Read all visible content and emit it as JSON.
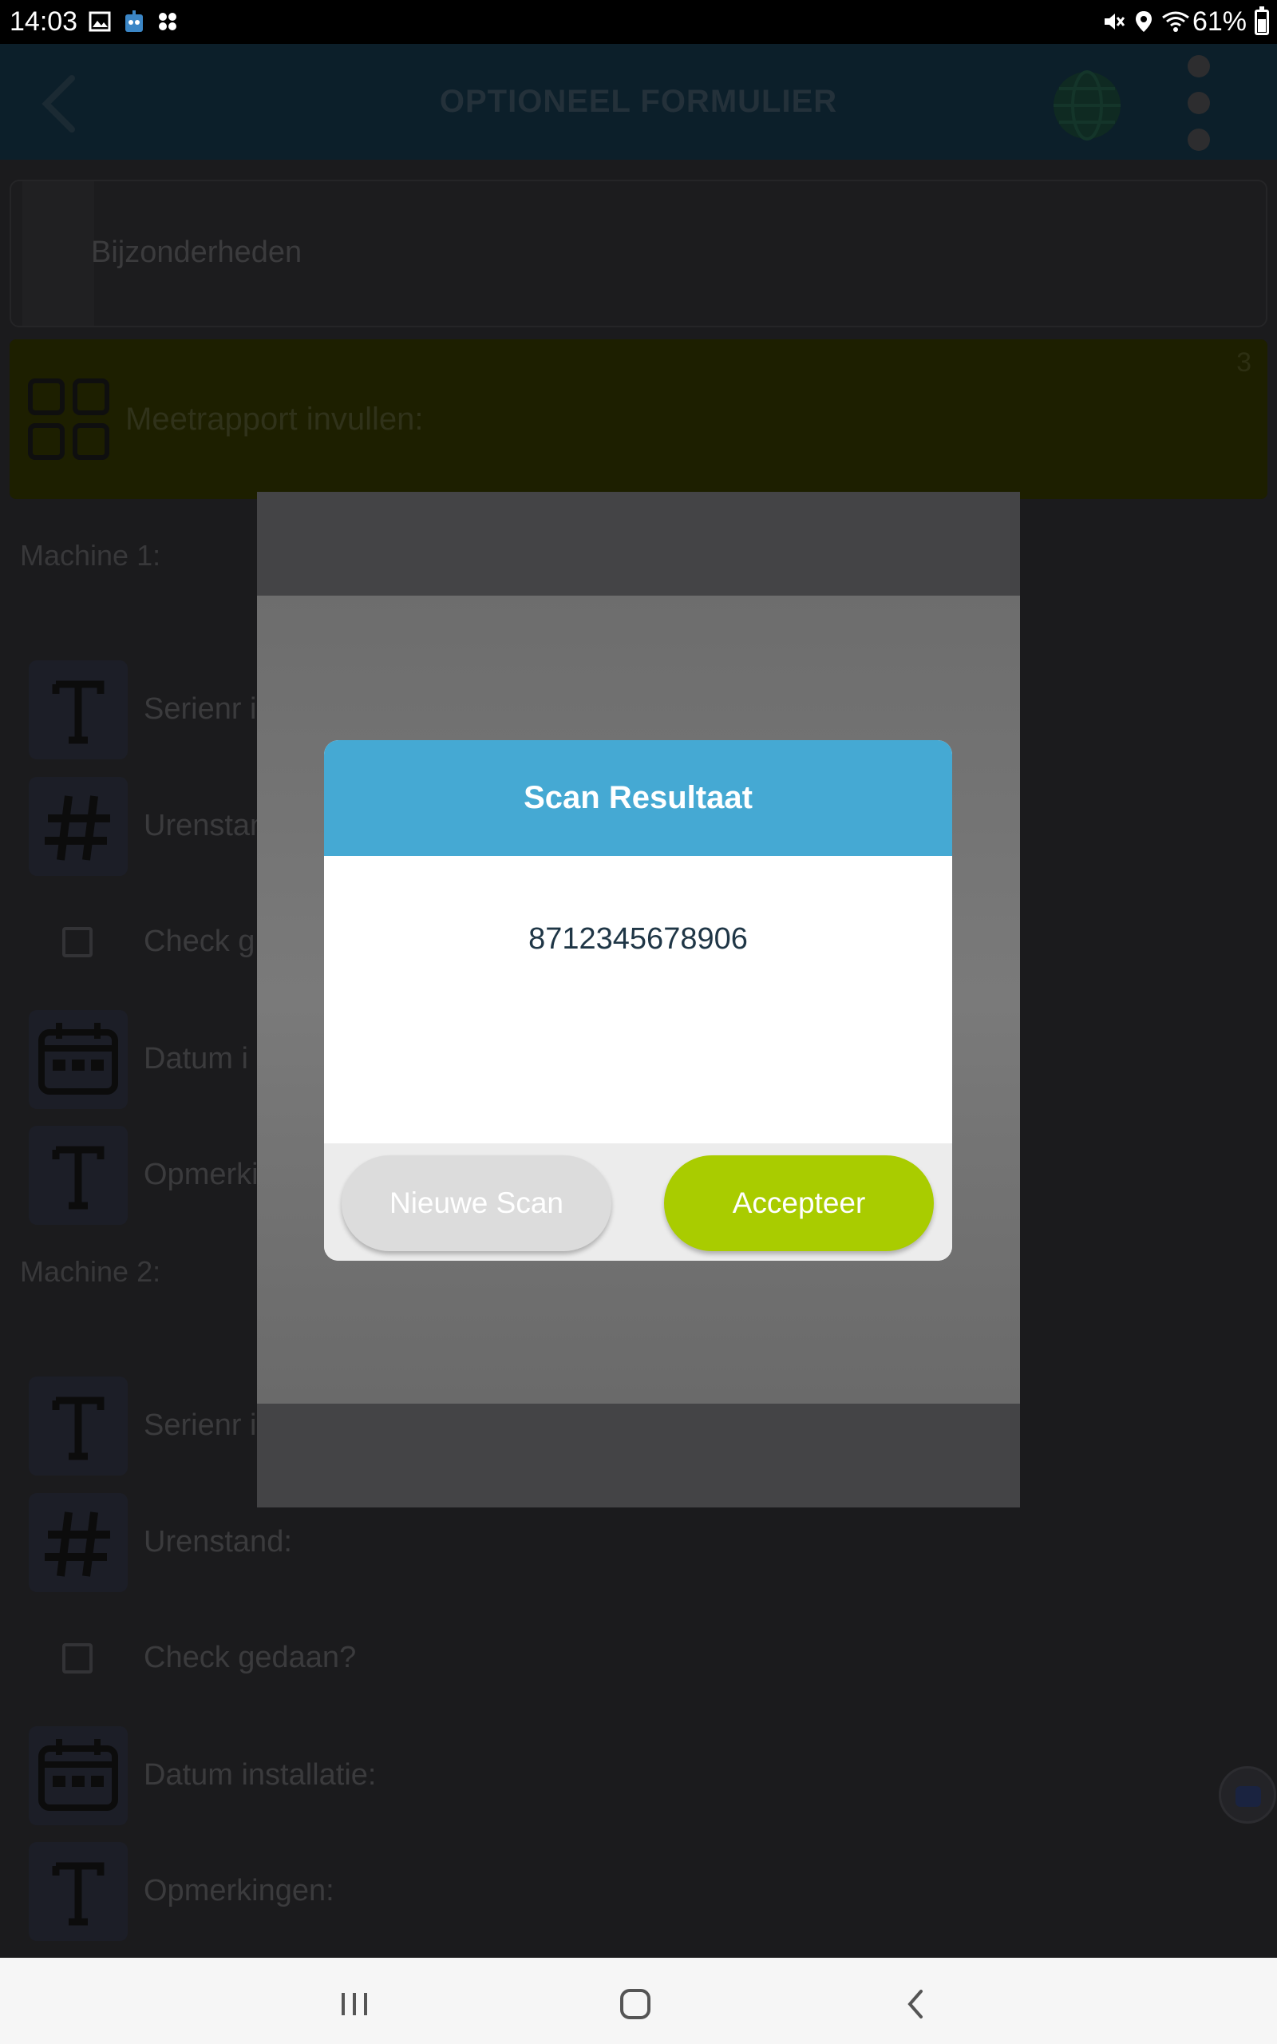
{
  "status_bar": {
    "time": "14:03",
    "battery": "61%",
    "battery_level": 0.61,
    "left_icons": [
      "gallery-icon",
      "robot-app-icon",
      "apps-icon"
    ],
    "right_icons": [
      "mute-icon",
      "location-icon",
      "wifi-icon",
      "battery-icon"
    ]
  },
  "app_bar": {
    "title": "OPTIONEEL FORMULIER",
    "icons": [
      "back-arrow-icon",
      "globe-icon",
      "more-vertical-icon"
    ]
  },
  "form": {
    "notes_card": {
      "label": "Bijzonderheden"
    },
    "group": {
      "label": "Meetrapport invullen:",
      "count": "3",
      "icon": "grid-form-icon"
    },
    "machines": [
      {
        "title": "Machine 1:",
        "fields": [
          {
            "type": "text",
            "icon": "text-field-icon",
            "label": "Serienr i"
          },
          {
            "type": "number",
            "icon": "hash-icon",
            "label": "Urenstan"
          },
          {
            "type": "checkbox",
            "icon": "checkbox-icon",
            "label": "Check g"
          },
          {
            "type": "date",
            "icon": "calendar-icon",
            "label": "Datum i"
          },
          {
            "type": "text",
            "icon": "text-field-icon",
            "label": "Opmerki"
          }
        ]
      },
      {
        "title": "Machine 2:",
        "fields": [
          {
            "type": "text",
            "icon": "text-field-icon",
            "label": "Serienr i"
          },
          {
            "type": "number",
            "icon": "hash-icon",
            "label": "Urenstand:"
          },
          {
            "type": "checkbox",
            "icon": "checkbox-icon",
            "label": "Check gedaan?"
          },
          {
            "type": "date",
            "icon": "calendar-icon",
            "label": "Datum installatie:"
          },
          {
            "type": "text",
            "icon": "text-field-icon",
            "label": "Opmerkingen:"
          }
        ]
      }
    ]
  },
  "dialog": {
    "title": "Scan Resultaat",
    "result": "8712345678906",
    "secondary_button": "Nieuwe Scan",
    "primary_button": "Accepteer"
  },
  "nav_bar": {
    "icons": [
      "recents-icon",
      "home-icon",
      "back-icon"
    ]
  },
  "colors": {
    "dialog_header": "#45a9d3",
    "accept_button": "#a9cc00",
    "secondary_button": "#dcdcdc",
    "result_text": "#1f3646",
    "status_bar": "#000000",
    "nav_bar": "#f6f6f6"
  }
}
